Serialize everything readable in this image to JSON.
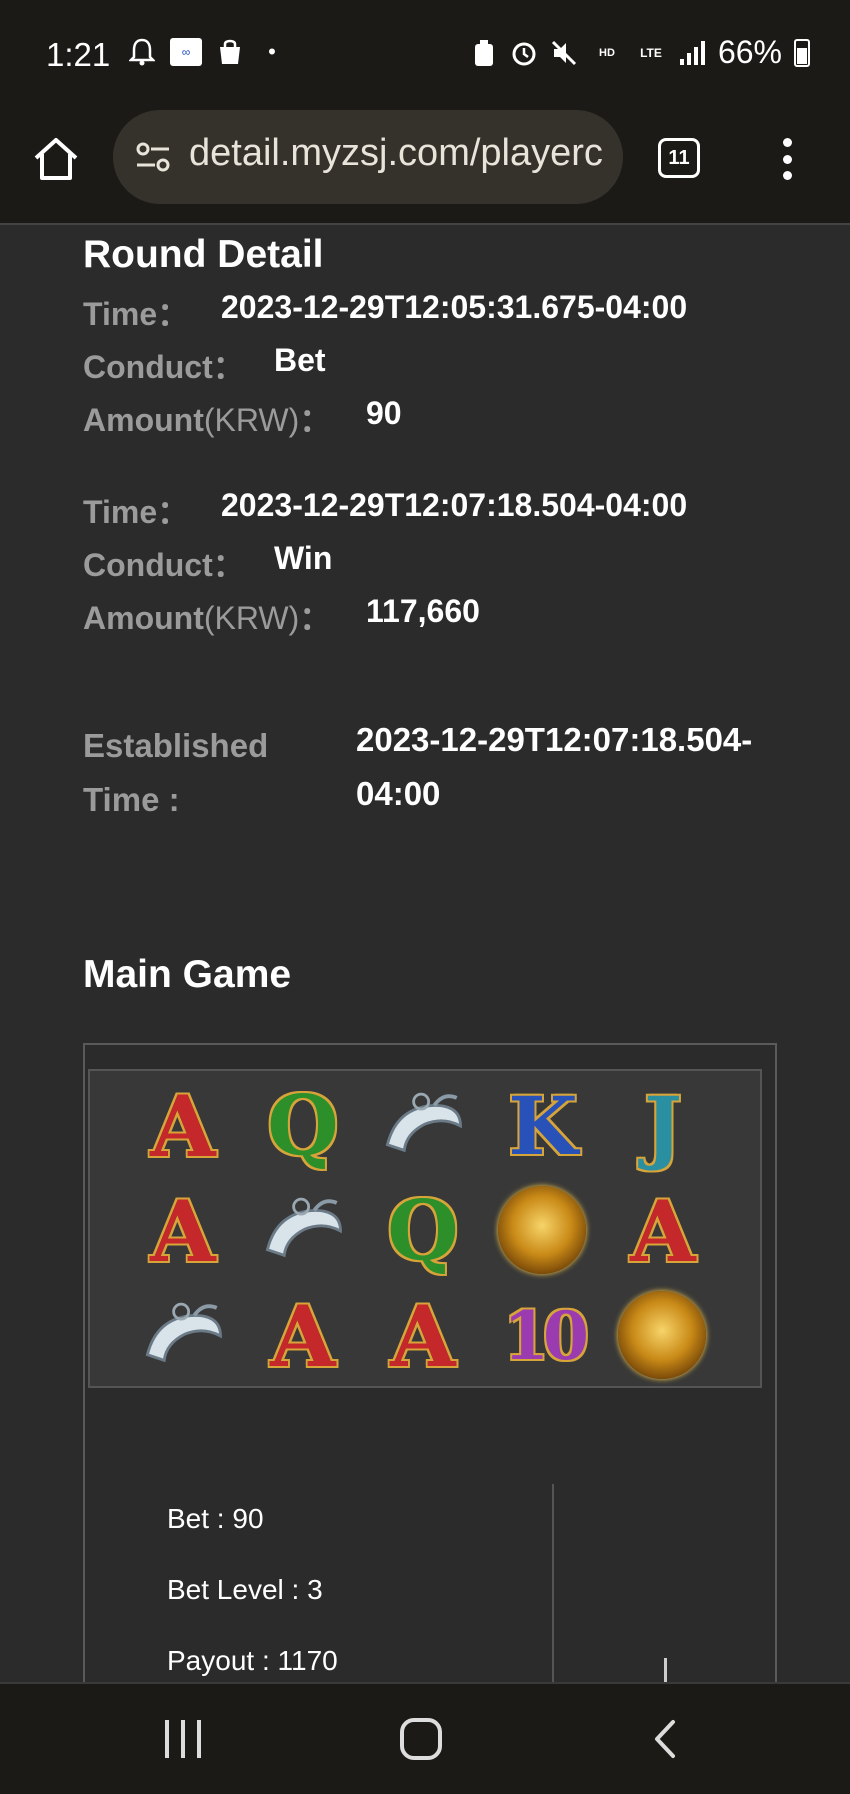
{
  "status_bar": {
    "time": "1:21",
    "battery": "66%"
  },
  "browser": {
    "url": "detail.myzsj.com/playerc",
    "tab_count": "11"
  },
  "round_detail": {
    "title": "Round Detail",
    "entries": [
      {
        "time_label": "Time：",
        "time": "2023-12-29T12:05:31.675-04:00",
        "conduct_label": "Conduct：",
        "conduct": "Bet",
        "amount_label": "Amount",
        "amount_unit": "(KRW)",
        "amount_colon": "：",
        "amount": "90"
      },
      {
        "time_label": "Time：",
        "time": "2023-12-29T12:07:18.504-04:00",
        "conduct_label": "Conduct：",
        "conduct": "Win",
        "amount_label": "Amount",
        "amount_unit": "(KRW)",
        "amount_colon": "：",
        "amount": "117,660"
      }
    ],
    "established_label_line1": "Established",
    "established_label_line2": "Time :",
    "established_value_line1": "2023-12-29T12:07:18.504-",
    "established_value_line2": "04:00"
  },
  "main_game": {
    "title": "Main Game",
    "reels": [
      [
        "A",
        "Q",
        "horn",
        "K",
        "J"
      ],
      [
        "A",
        "horn",
        "Q",
        "wild",
        "A"
      ],
      [
        "horn",
        "A",
        "A",
        "10",
        "wild"
      ]
    ],
    "bet_label": "Bet : 90",
    "bet_level_label": "Bet Level : 3",
    "payout_label": "Payout : 1170"
  }
}
